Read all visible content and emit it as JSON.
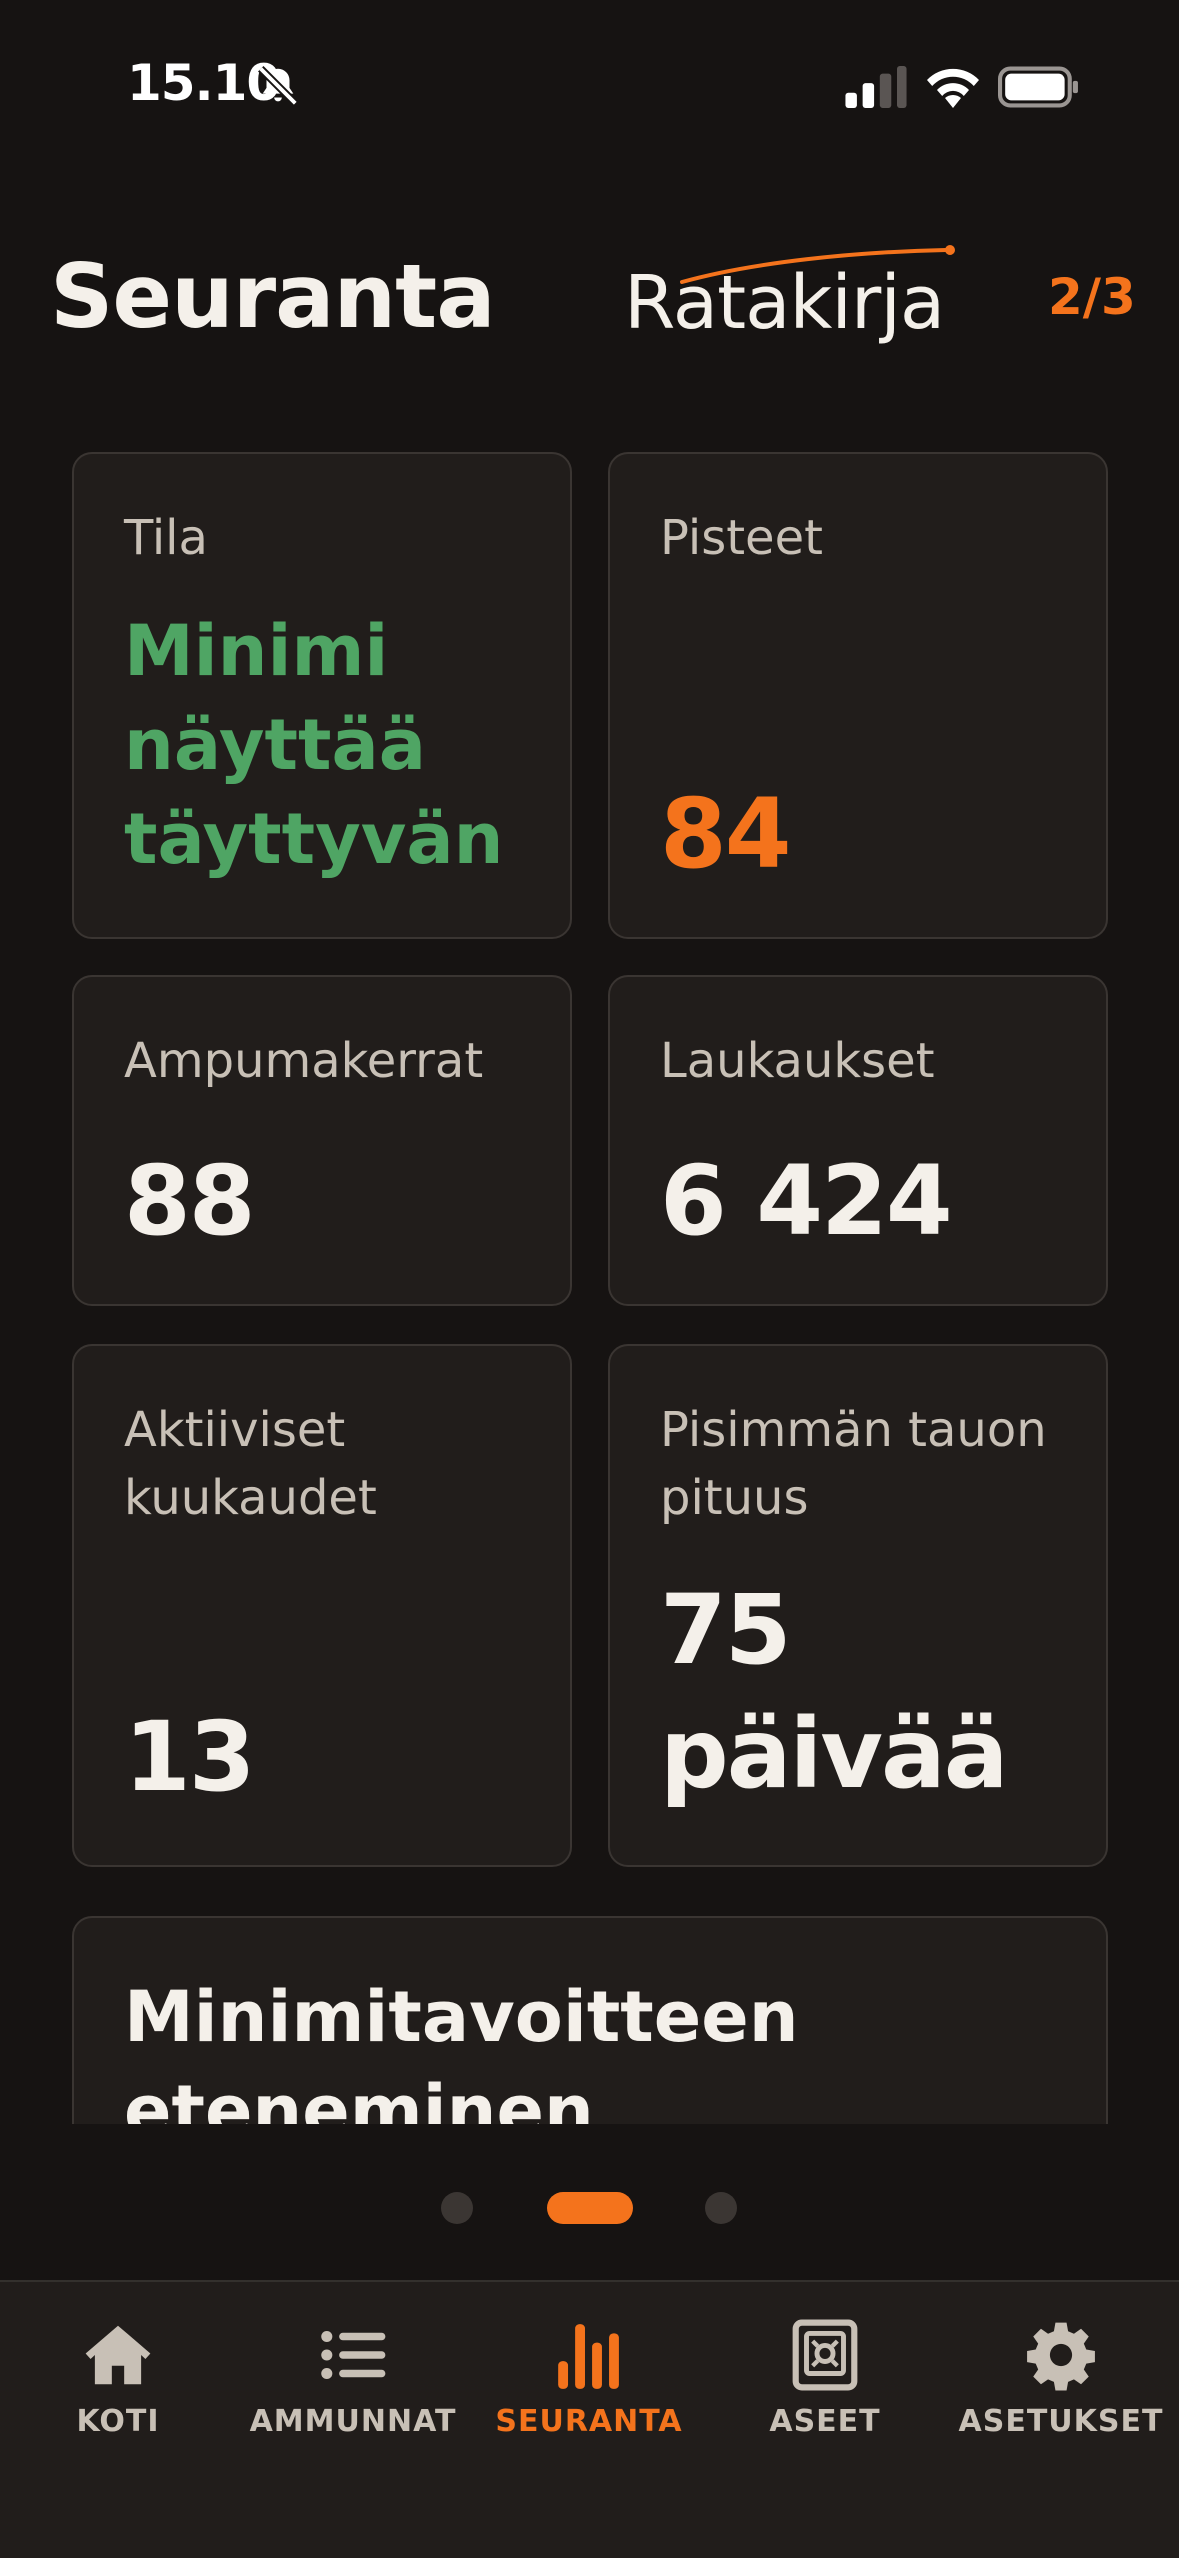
{
  "status_bar": {
    "time": "15.10",
    "icons": [
      "bell-off-icon",
      "signal-icon",
      "wifi-icon",
      "battery-icon"
    ]
  },
  "header": {
    "title": "Seuranta",
    "logo_text": "Ratakirja",
    "page_counter": "2/3"
  },
  "cards": {
    "tila": {
      "label": "Tila",
      "value": "Minimi näyttää täyttyvän"
    },
    "pisteet": {
      "label": "Pisteet",
      "value": "84"
    },
    "ampumakerrat": {
      "label": "Ampumakerrat",
      "value": "88"
    },
    "laukaukset": {
      "label": "Laukaukset",
      "value": "6 424"
    },
    "kuukaudet": {
      "label": "Aktiiviset kuukaudet",
      "value": "13"
    },
    "tauko": {
      "label": "Pisimmän tauon pituus",
      "value": "75 päivää"
    },
    "progress": {
      "title": "Minimitavoitteen eteneminen"
    }
  },
  "pager": {
    "count": 3,
    "active_index": 1
  },
  "tab_bar": {
    "tabs": [
      {
        "label": "KOTI",
        "icon": "home-icon"
      },
      {
        "label": "AMMUNNAT",
        "icon": "list-icon"
      },
      {
        "label": "SEURANTA",
        "icon": "bar-chart-icon",
        "active": true
      },
      {
        "label": "ASEET",
        "icon": "safe-icon"
      },
      {
        "label": "ASETUKSET",
        "icon": "gear-icon"
      }
    ]
  },
  "colors": {
    "background": "#161312",
    "card": "#211d1b",
    "accent": "#f4731c",
    "status_ok": "#4fa564"
  }
}
